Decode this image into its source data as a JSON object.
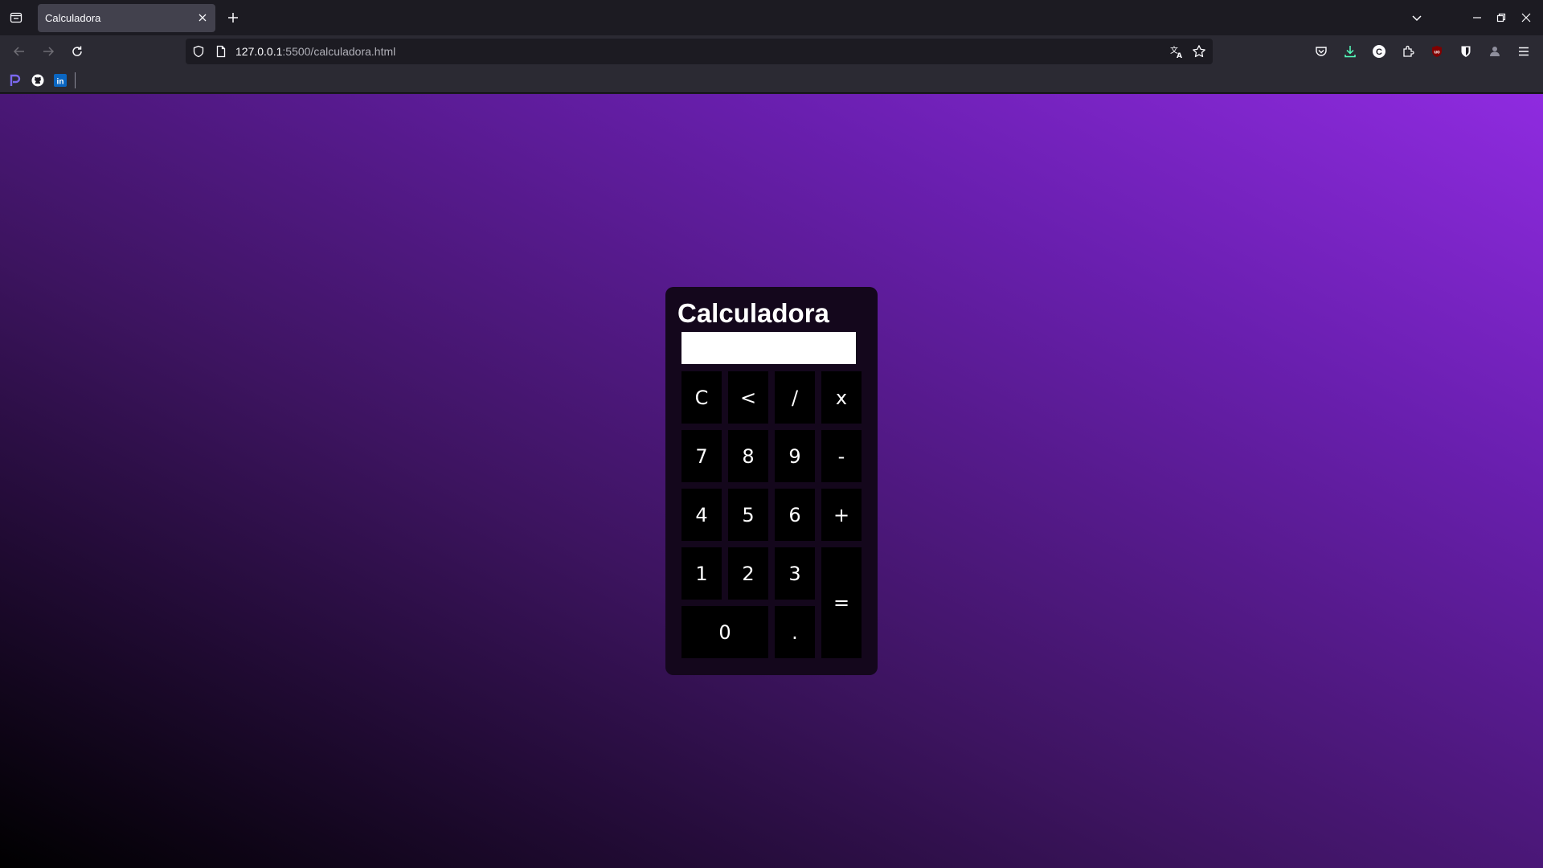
{
  "browser": {
    "tab": {
      "title": "Calculadora"
    },
    "url": {
      "host": "127.0.0.1",
      "rest": ":5500/calculadora.html"
    }
  },
  "calculator": {
    "title": "Calculadora",
    "display_value": "",
    "keys": {
      "clear": "C",
      "backspace": "<",
      "divide": "/",
      "multiply": "x",
      "seven": "7",
      "eight": "8",
      "nine": "9",
      "minus": "-",
      "four": "4",
      "five": "5",
      "six": "6",
      "plus": "+",
      "one": "1",
      "two": "2",
      "three": "3",
      "equals": "=",
      "zero": "0",
      "decimal": "."
    }
  },
  "colors": {
    "calculator_background": "#14071c",
    "key_background": "#000000",
    "key_text": "#ffffff",
    "gradient": [
      "#000000",
      "#3d1460",
      "#6a1fb0",
      "#8f2be0"
    ]
  }
}
